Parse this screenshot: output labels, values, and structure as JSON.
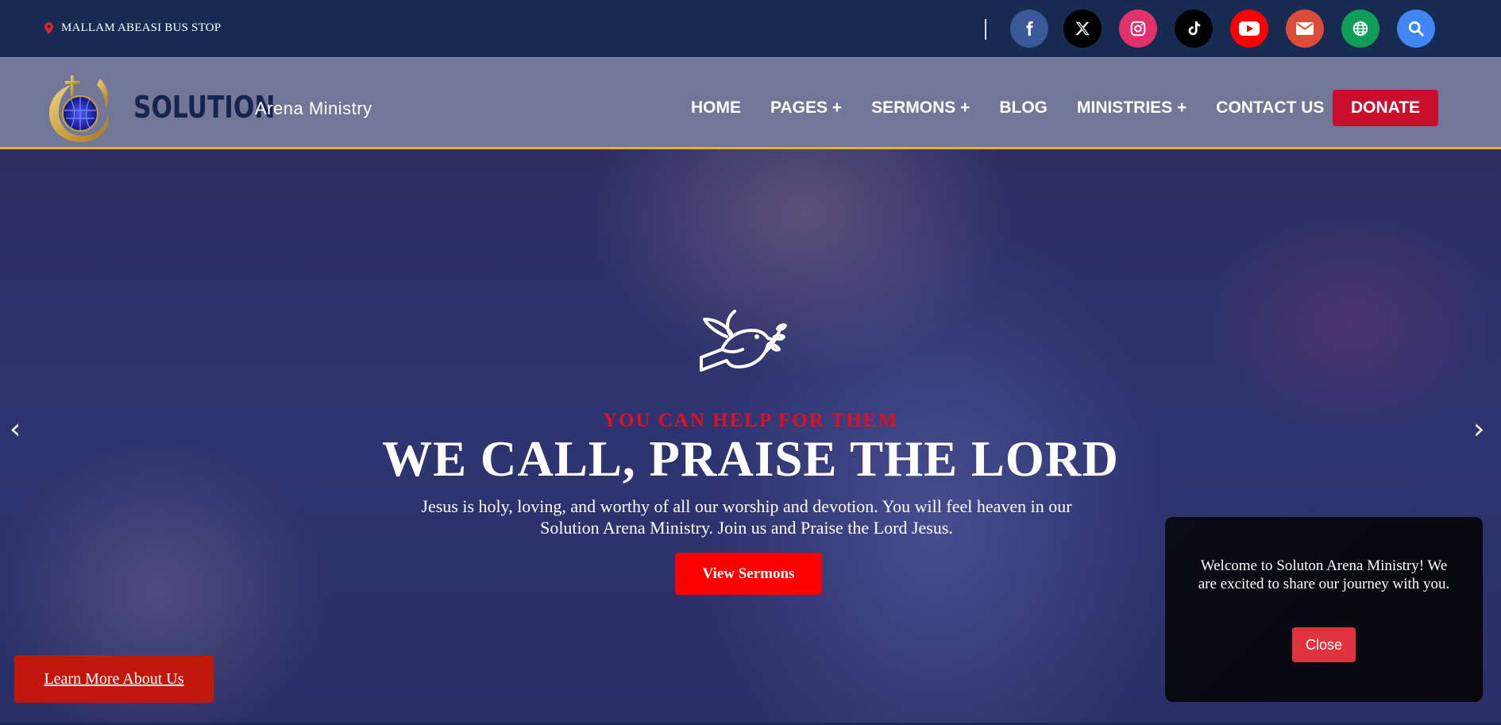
{
  "topbar": {
    "location": "MALLAM ABEASI BUS STOP",
    "location_icon": "map-pin-icon",
    "socials": [
      {
        "name": "facebook-icon",
        "color": "#3b5998"
      },
      {
        "name": "x-twitter-icon",
        "color": "#000000"
      },
      {
        "name": "instagram-icon",
        "color": "#e1306c"
      },
      {
        "name": "tiktok-icon",
        "color": "#010101"
      },
      {
        "name": "youtube-icon",
        "color": "#ff0000"
      },
      {
        "name": "email-icon",
        "color": "#dd4b39"
      },
      {
        "name": "website-globe-icon",
        "color": "#0f9d58"
      },
      {
        "name": "search-icon",
        "color": "#4285f4"
      }
    ]
  },
  "header": {
    "brand": "SOLUTION",
    "brand_sub": "Arena Ministry",
    "nav": [
      "HOME",
      "PAGES +",
      "SERMONS +",
      "BLOG",
      "MINISTRIES +",
      "CONTACT US"
    ],
    "donate": "DONATE",
    "accent": "#e5b41c"
  },
  "hero": {
    "eyebrow": "YOU CAN HELP FOR THEM",
    "headline": "WE CALL, PRAISE THE LORD",
    "lead": "Jesus is holy, loving, and worthy of all our worship and devotion. You will feel heaven in our Solution Arena Ministry. Join us and Praise the Lord Jesus.",
    "cta": "View Sermons",
    "prev": "‹",
    "next": "›",
    "learn_more": "Learn More About Us"
  },
  "popup": {
    "message": "Welcome to Soluton Arena Ministry! We are excited to share our journey with you.",
    "close": "Close"
  }
}
